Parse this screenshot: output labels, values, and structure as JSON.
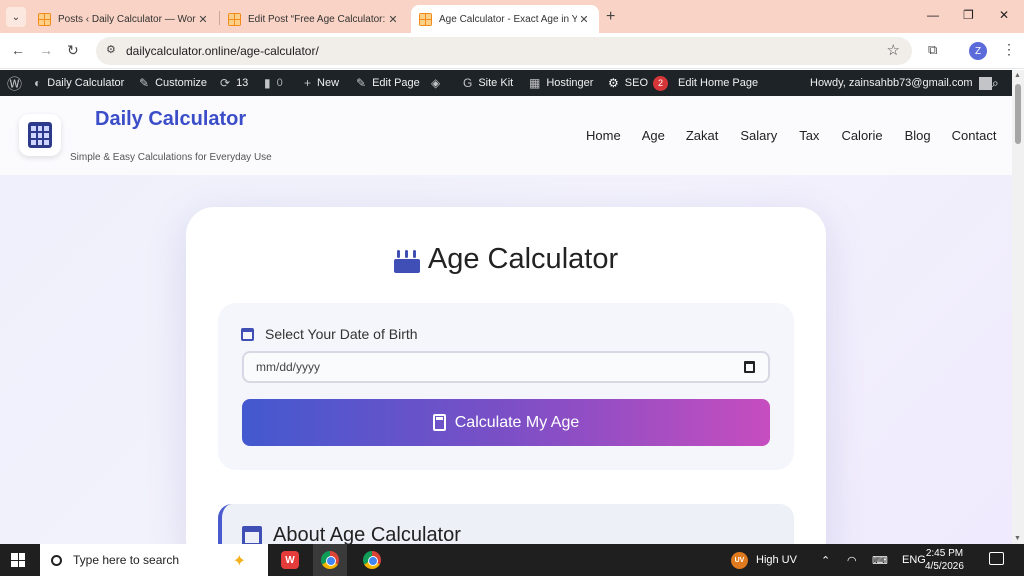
{
  "browser": {
    "tabs": [
      {
        "title": "Posts ‹ Daily Calculator — Word",
        "close": "✕"
      },
      {
        "title": "Edit Post “Free Age Calculator: F",
        "close": "✕"
      },
      {
        "title": "Age Calculator - Exact Age in Yea",
        "close": "✕",
        "active": true
      }
    ],
    "new_tab": "+",
    "window_controls": {
      "minimize": "—",
      "restore": "❐",
      "close": "✕"
    },
    "url": "dailycalculator.online/age-calculator/",
    "profile_initial": "Z"
  },
  "wp_admin_bar": {
    "site_name": "Daily Calculator",
    "customize": "Customize",
    "updates_count": "13",
    "comments_count": "0",
    "new": "New",
    "edit_page": "Edit Page",
    "site_kit": "Site Kit",
    "hostinger": "Hostinger",
    "seo": "SEO",
    "seo_badge": "2",
    "edit_home_page": "Edit Home Page",
    "howdy": "Howdy, zainsahbb73@gmail.com"
  },
  "site": {
    "title": "Daily Calculator",
    "tagline": "Simple & Easy Calculations for Everyday Use",
    "nav": [
      "Home",
      "Age",
      "Zakat",
      "Salary",
      "Tax",
      "Calorie",
      "Blog",
      "Contact"
    ]
  },
  "calculator": {
    "title": "Age Calculator",
    "dob_label": "Select Your Date of Birth",
    "dob_placeholder": "mm/dd/yyyy",
    "button": "Calculate My Age"
  },
  "about": {
    "title": "About Age Calculator"
  },
  "taskbar": {
    "search_placeholder": "Type here to search",
    "wps_label": "W",
    "weather": "High UV",
    "uv_badge": "UV",
    "language": "ENG",
    "time": "2:45 PM",
    "date": "4/5/2026"
  },
  "colors": {
    "accent": "#3b4ec8",
    "button_gradient_start": "#4359cf",
    "button_gradient_end": "#c64dbf",
    "tab_bar": "#f9d3c5",
    "wp_bar": "#1d2327"
  }
}
